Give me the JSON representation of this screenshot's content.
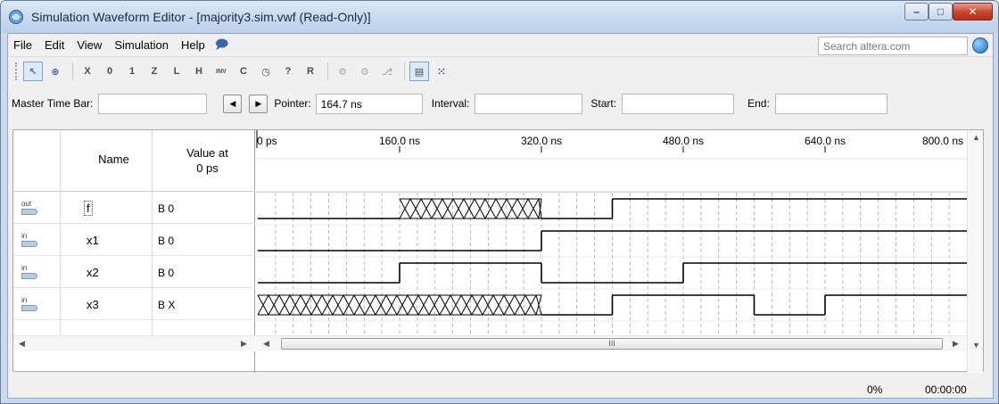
{
  "window": {
    "title": "Simulation Waveform Editor - [majority3.sim.vwf (Read-Only)]",
    "minimize": "–",
    "maximize": "□",
    "close": "✕"
  },
  "menu": {
    "items": [
      "File",
      "Edit",
      "View",
      "Simulation",
      "Help"
    ],
    "search_placeholder": "Search altera.com"
  },
  "toolbar": {
    "buttons": [
      {
        "icon": "selection-tool-icon",
        "glyph": "↖",
        "selected": true
      },
      {
        "icon": "zoom-tool-icon",
        "glyph": "⊕"
      },
      {
        "icon": "forcing-unknown-icon",
        "glyph": "X"
      },
      {
        "icon": "forcing-low-icon",
        "glyph": "0"
      },
      {
        "icon": "forcing-high-icon",
        "glyph": "1"
      },
      {
        "icon": "high-impedance-icon",
        "glyph": "Z"
      },
      {
        "icon": "weak-low-icon",
        "glyph": "L"
      },
      {
        "icon": "weak-high-icon",
        "glyph": "H"
      },
      {
        "icon": "invert-icon",
        "glyph": "INV"
      },
      {
        "icon": "count-value-icon",
        "glyph": "C"
      },
      {
        "icon": "clock-icon",
        "glyph": "◷"
      },
      {
        "icon": "arbitrary-value-icon",
        "glyph": "?"
      },
      {
        "icon": "random-value-icon",
        "glyph": "R"
      },
      {
        "icon": "functional-simulation-icon",
        "glyph": "⚙",
        "dim": true
      },
      {
        "icon": "timing-simulation-icon",
        "glyph": "⚙",
        "dim": true
      },
      {
        "icon": "netlist-viewer-icon",
        "glyph": "⎇",
        "dim": true
      },
      {
        "icon": "snap-to-grid-icon",
        "glyph": "▤",
        "selected": true
      },
      {
        "icon": "grid-options-icon",
        "glyph": "⁙"
      }
    ]
  },
  "timebar": {
    "master_label": "Master Time Bar:",
    "master_value": "",
    "pointer_label": "Pointer:",
    "pointer_value": "164.7 ns",
    "interval_label": "Interval:",
    "interval_value": "",
    "start_label": "Start:",
    "start_value": "",
    "end_label": "End:",
    "end_value": ""
  },
  "table": {
    "name_header": "Name",
    "value_header_line1": "Value at",
    "value_header_line2": "0 ps",
    "rows": [
      {
        "type": "out",
        "name": "f",
        "value": "B 0"
      },
      {
        "type": "in",
        "name": "x1",
        "value": "B 0"
      },
      {
        "type": "in",
        "name": "x2",
        "value": "B 0"
      },
      {
        "type": "in",
        "name": "x3",
        "value": "B X"
      }
    ]
  },
  "waveform": {
    "time_labels": [
      "0 ps",
      "160.0 ns",
      "320.0 ns",
      "480.0 ns",
      "640.0 ns",
      "800.0 ns"
    ],
    "time_range_ns": [
      0,
      800
    ],
    "grid_step_ns": 20,
    "signals": [
      {
        "name": "f",
        "segments": [
          {
            "from": 0,
            "to": 160,
            "v": "0"
          },
          {
            "from": 160,
            "to": 320,
            "v": "X"
          },
          {
            "from": 320,
            "to": 400,
            "v": "0"
          },
          {
            "from": 400,
            "to": 800,
            "v": "1"
          }
        ]
      },
      {
        "name": "x1",
        "segments": [
          {
            "from": 0,
            "to": 320,
            "v": "0"
          },
          {
            "from": 320,
            "to": 800,
            "v": "1"
          }
        ]
      },
      {
        "name": "x2",
        "segments": [
          {
            "from": 0,
            "to": 160,
            "v": "0"
          },
          {
            "from": 160,
            "to": 320,
            "v": "1"
          },
          {
            "from": 320,
            "to": 480,
            "v": "0"
          },
          {
            "from": 480,
            "to": 800,
            "v": "1"
          }
        ]
      },
      {
        "name": "x3",
        "segments": [
          {
            "from": 0,
            "to": 320,
            "v": "X"
          },
          {
            "from": 320,
            "to": 400,
            "v": "0"
          },
          {
            "from": 400,
            "to": 560,
            "v": "1"
          },
          {
            "from": 560,
            "to": 640,
            "v": "0"
          },
          {
            "from": 640,
            "to": 800,
            "v": "1"
          }
        ]
      }
    ]
  },
  "scroll": {
    "thumb_glyph": "III"
  },
  "status": {
    "percent": "0%",
    "elapsed": "00:00:00"
  }
}
